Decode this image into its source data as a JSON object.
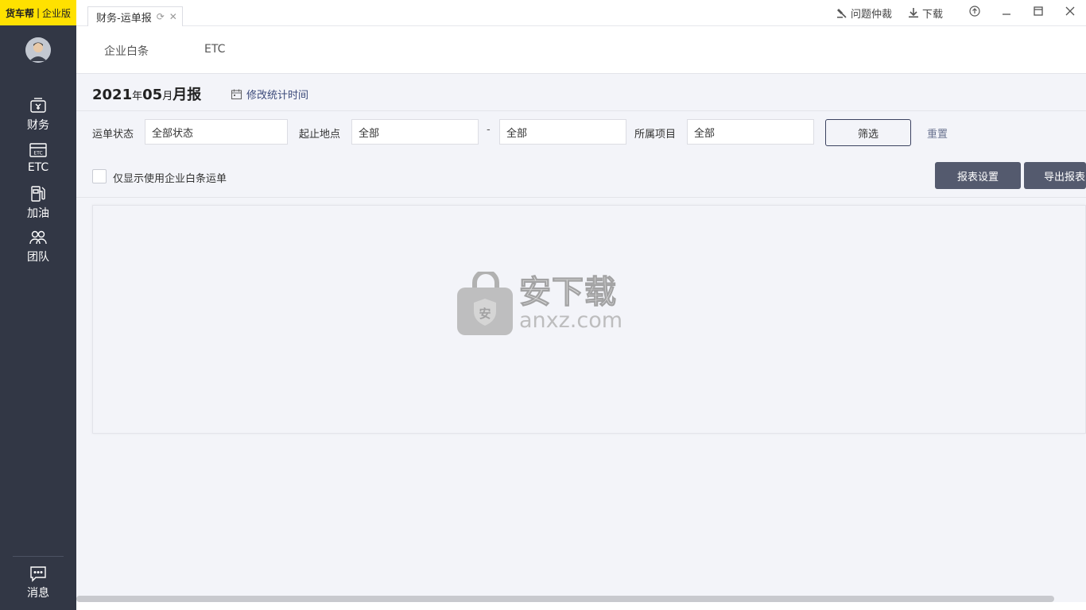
{
  "brand": {
    "logo": "货车帮",
    "separator": "|",
    "edition": "企业版"
  },
  "sidebar": {
    "items": [
      {
        "label": "财务",
        "icon": "finance-icon"
      },
      {
        "label": "ETC",
        "icon": "etc-icon"
      },
      {
        "label": "加油",
        "icon": "fuel-icon"
      },
      {
        "label": "团队",
        "icon": "team-icon"
      }
    ],
    "bottom": {
      "label": "消息",
      "icon": "message-icon"
    }
  },
  "tabbar": {
    "active_tab": "财务-运单报",
    "actions": [
      {
        "label": "问题仲裁",
        "icon": "gavel-icon"
      },
      {
        "label": "下载",
        "icon": "download-icon"
      }
    ]
  },
  "subtabs": [
    "企业白条",
    "ETC"
  ],
  "report": {
    "year": "2021",
    "year_unit": "年",
    "month": "05",
    "month_unit": "月",
    "title_suffix": "月报",
    "edit_time_label": "修改统计时间"
  },
  "filters": {
    "status_label": "运单状态",
    "status_value": "全部状态",
    "place_label": "起止地点",
    "place_from": "全部",
    "dash": "-",
    "place_to": "全部",
    "project_label": "所属项目",
    "project_value": "全部",
    "filter_button": "筛选",
    "reset_button": "重置"
  },
  "options": {
    "only_credit_label": "仅显示使用企业白条运单",
    "only_credit_checked": false,
    "report_settings_button": "报表设置",
    "export_button": "导出报表"
  },
  "watermark": {
    "cn": "安下载",
    "en": "anxz.com",
    "badge": "安"
  }
}
